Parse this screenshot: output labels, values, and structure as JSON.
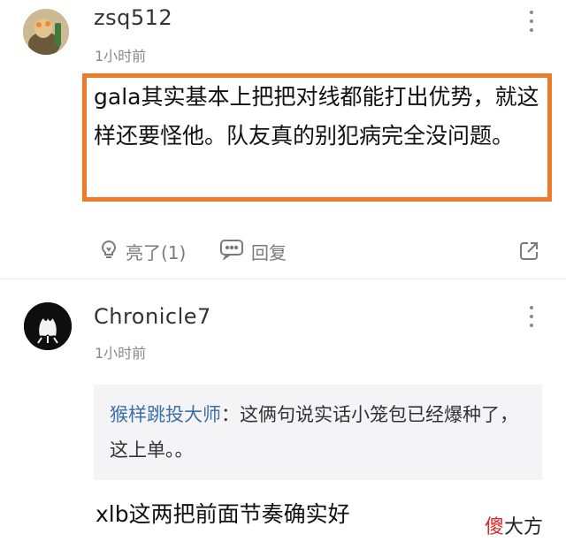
{
  "comments": [
    {
      "username": "zsq512",
      "time": "1小时前",
      "text": "gala其实基本上把把对线都能打出优势，就这样还要怪他。队友真的别犯病完全没问题。",
      "actions": {
        "like": "亮了(1)",
        "reply": "回复"
      }
    },
    {
      "username": "Chronicle7",
      "time": "1小时前",
      "quote": {
        "author": "猴样跳投大师",
        "separator": "：",
        "text": "这俩句说实话小笼包已经爆种了，这上单。。"
      },
      "text": "xlb这两把前面节奏确实好"
    }
  ],
  "watermark": {
    "first": "傻",
    "rest": "大方"
  },
  "icons": {
    "like": "lightbulb-icon",
    "reply": "chat-bubble-icon",
    "share": "share-icon",
    "more": "more-vertical-icon"
  },
  "colors": {
    "highlight_border": "#f07a2a",
    "quote_author": "#3d6fa8",
    "watermark_accent": "#d8262a"
  }
}
